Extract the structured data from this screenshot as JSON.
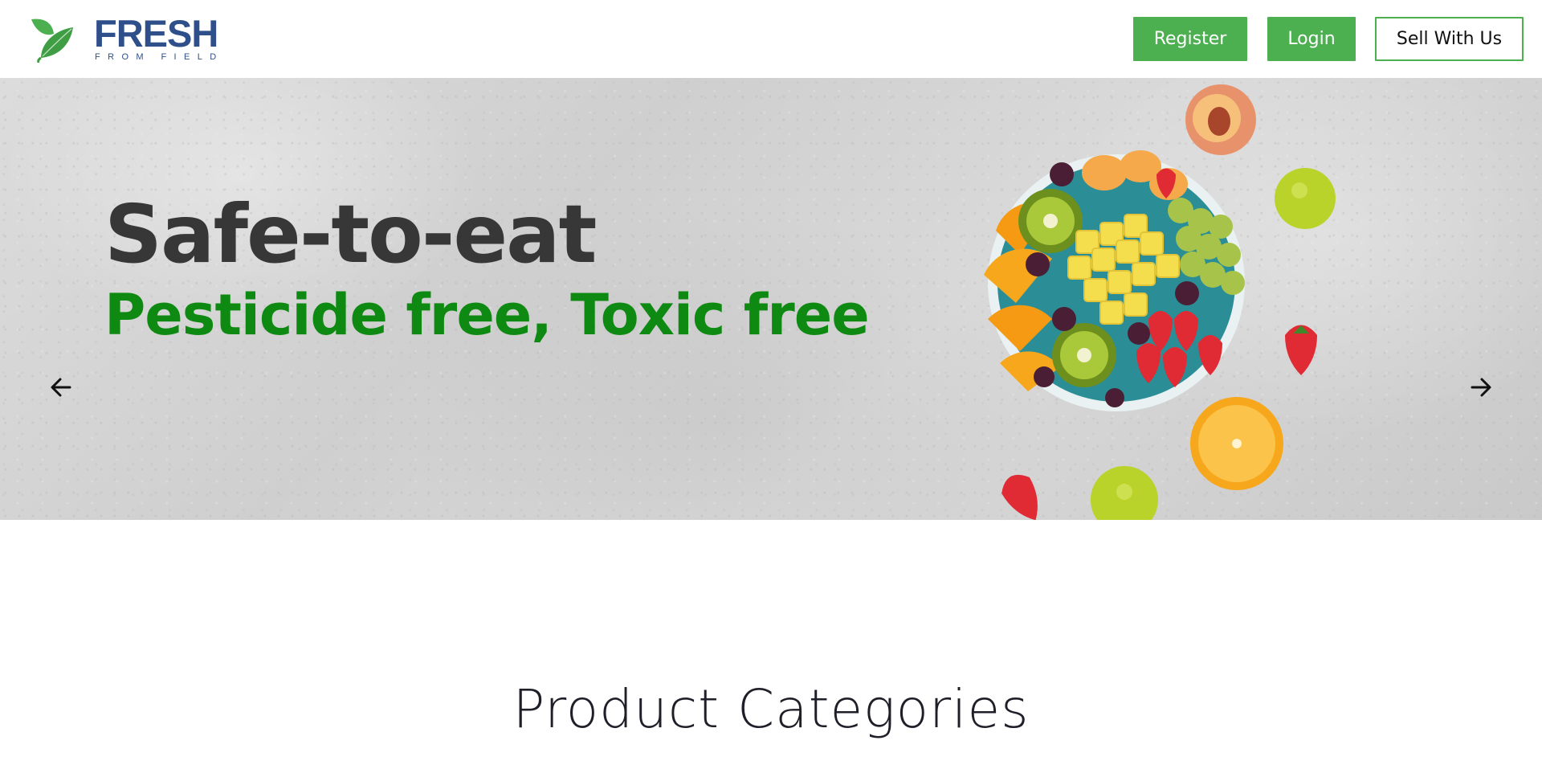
{
  "brand": {
    "name_main": "FRESH",
    "name_sub": "FROM FIELD",
    "colors": {
      "primary": "#2e4f8a",
      "leaf": "#4caf50"
    }
  },
  "header": {
    "register_label": "Register",
    "login_label": "Login",
    "sell_label": "Sell With Us"
  },
  "hero": {
    "title": "Safe-to-eat",
    "subtitle": "Pesticide free, Toxic free",
    "prev_icon": "arrow-left-icon",
    "next_icon": "arrow-right-icon",
    "colors": {
      "title": "#373737",
      "subtitle": "#0e8a12"
    }
  },
  "sections": {
    "categories_title": "Product Categories"
  },
  "theme": {
    "accent": "#4caf50",
    "button_text": "#ffffff"
  }
}
